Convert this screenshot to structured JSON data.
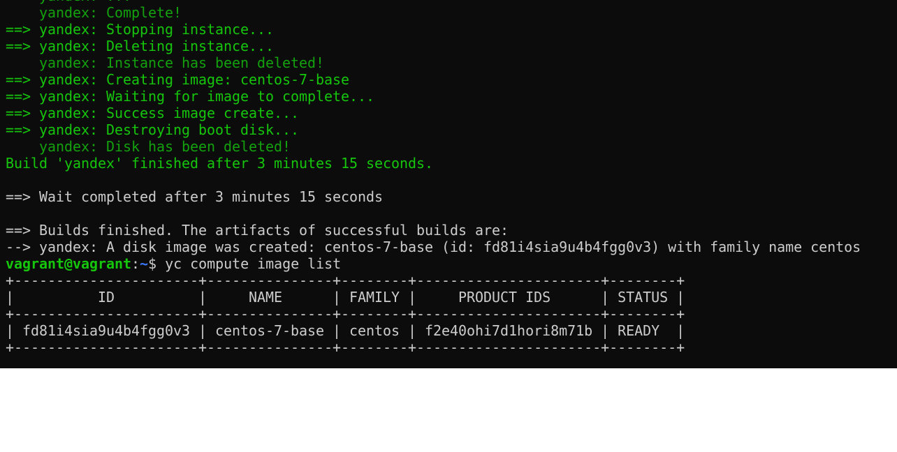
{
  "terminal": {
    "output": [
      {
        "text": "    yandex: ...",
        "cls": "dg"
      },
      {
        "text": "    yandex: Complete!",
        "cls": "dg"
      },
      {
        "text": "==> yandex: Stopping instance...",
        "cls": "g"
      },
      {
        "text": "==> yandex: Deleting instance...",
        "cls": "g"
      },
      {
        "text": "    yandex: Instance has been deleted!",
        "cls": "dg"
      },
      {
        "text": "==> yandex: Creating image: centos-7-base",
        "cls": "g"
      },
      {
        "text": "==> yandex: Waiting for image to complete...",
        "cls": "g"
      },
      {
        "text": "==> yandex: Success image create...",
        "cls": "g"
      },
      {
        "text": "==> yandex: Destroying boot disk...",
        "cls": "g"
      },
      {
        "text": "    yandex: Disk has been deleted!",
        "cls": "dg"
      },
      {
        "text": "Build 'yandex' finished after 3 minutes 15 seconds.",
        "cls": "g"
      },
      {
        "text": "",
        "cls": "w"
      },
      {
        "text": "==> Wait completed after 3 minutes 15 seconds",
        "cls": "w"
      },
      {
        "text": "",
        "cls": "w"
      },
      {
        "text": "==> Builds finished. The artifacts of successful builds are:",
        "cls": "w"
      },
      {
        "text": "--> yandex: A disk image was created: centos-7-base (id: fd81i4sia9u4b4fgg0v3) with family name centos",
        "cls": "w"
      }
    ],
    "prompt": {
      "user_host": "vagrant@vagrant",
      "colon": ":",
      "path": "~",
      "dollar": "$ ",
      "command": "yc compute image list"
    },
    "table": [
      "+----------------------+---------------+--------+----------------------+--------+",
      "|          ID          |     NAME      | FAMILY |     PRODUCT IDS      | STATUS |",
      "+----------------------+---------------+--------+----------------------+--------+",
      "| fd81i4sia9u4b4fgg0v3 | centos-7-base | centos | f2e40ohi7d1hori8m71b | READY  |",
      "+----------------------+---------------+--------+----------------------+--------+"
    ],
    "colors": {
      "background": "#0c0c0c",
      "green": "#16c60c",
      "dark_green": "#13a10e",
      "text": "#cccccc",
      "path_blue": "#3b78ff"
    }
  }
}
